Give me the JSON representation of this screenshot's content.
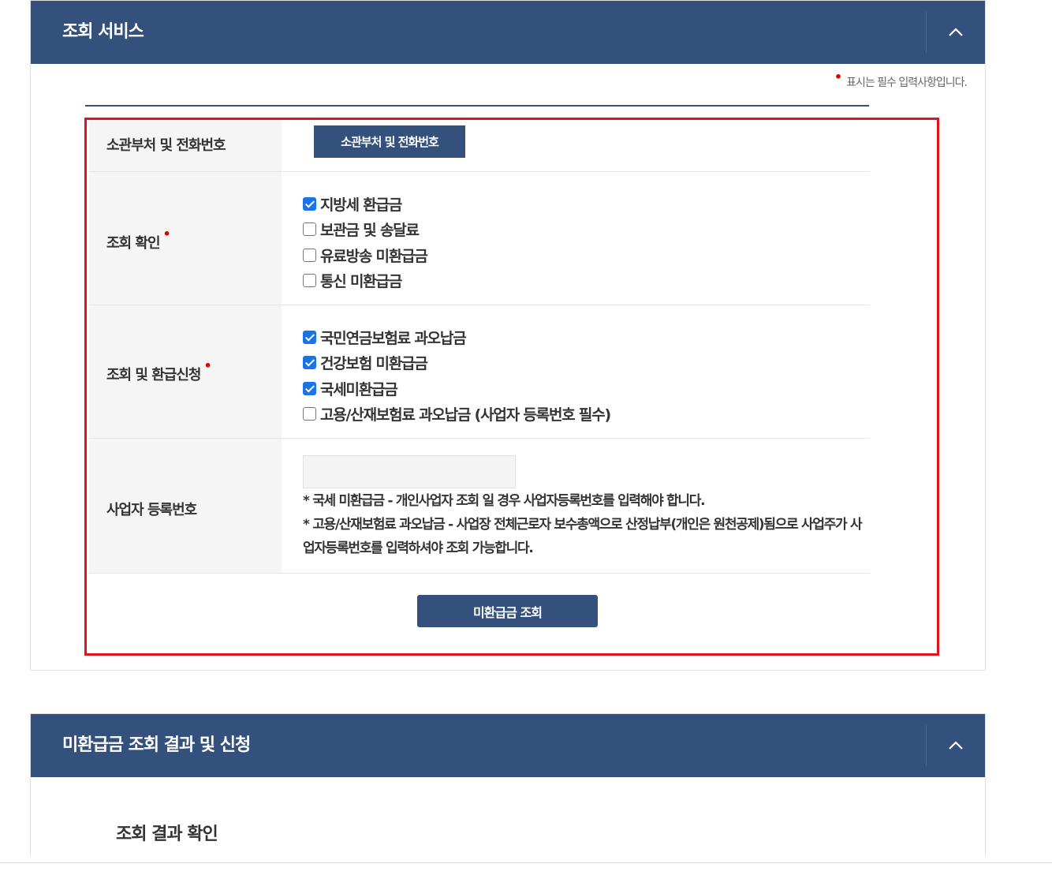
{
  "panel1": {
    "title": "조회 서비스",
    "required_note": "표시는 필수 입력사항입니다.",
    "required_mark": "•",
    "rows": {
      "dept": {
        "label": "소관부처 및 전화번호",
        "button_label": "소관부처 및 전화번호"
      },
      "inquiry": {
        "label": "조회 확인",
        "options": [
          {
            "label": "지방세 환급금",
            "checked": true
          },
          {
            "label": "보관금 및 송달료",
            "checked": false
          },
          {
            "label": "유료방송 미환급금",
            "checked": false
          },
          {
            "label": "통신 미환급금",
            "checked": false
          }
        ]
      },
      "refund": {
        "label": "조회 및 환급신청",
        "options": [
          {
            "label": "국민연금보험료 과오납금",
            "checked": true
          },
          {
            "label": "건강보험 미환급금",
            "checked": true
          },
          {
            "label": "국세미환급금",
            "checked": true
          },
          {
            "label": "고용/산재보험료 과오납금 (사업자 등록번호 필수)",
            "checked": false
          }
        ]
      },
      "business": {
        "label": "사업자 등록번호",
        "input_value": "",
        "note_1": "* 국세 미환급금 - 개인사업자 조회 일 경우 사업자등록번호를 입력해야 합니다.",
        "note_2": "* 고용/산재보험료 과오납금 - 사업장 전체근로자 보수총액으로 산정납부(개인은 원천공제)됨으로 사업주가 사업자등록번호를 입력하셔야 조회 가능합니다."
      }
    },
    "search_button": "미환급금 조회"
  },
  "panel2": {
    "title": "미환급금 조회 결과 및 신청",
    "section_heading": "조회 결과 확인"
  },
  "colors": {
    "header": "#34507c",
    "highlight_border": "#e1141e",
    "required": "#e00000",
    "checkbox": "#1a73e8"
  },
  "icons": {
    "collapse": "chevron-up-icon"
  }
}
